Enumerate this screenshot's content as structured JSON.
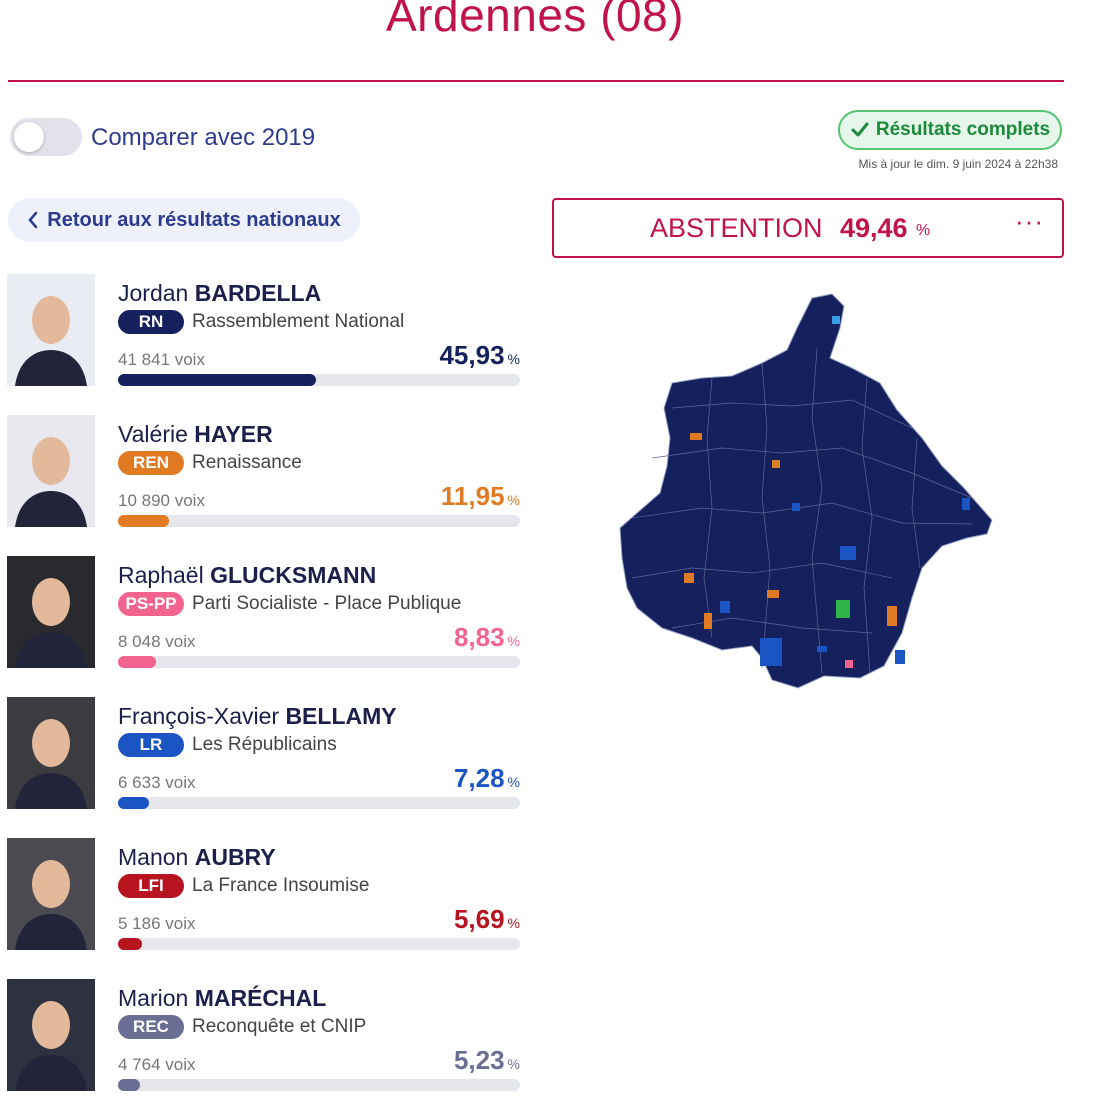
{
  "header": {
    "title": "Ardennes (08)"
  },
  "compare": {
    "label": "Comparer avec 2019"
  },
  "status": {
    "badge": "Résultats complets",
    "updated": "Mis à jour le dim. 9 juin 2024 à 22h38"
  },
  "nav": {
    "back_label": "Retour aux résultats nationaux"
  },
  "abstention": {
    "label": "ABSTENTION",
    "value": "49,46",
    "unit": "%"
  },
  "candidates": [
    {
      "first": "Jordan",
      "last": "BARDELLA",
      "party_code": "RN",
      "party_name": "Rassemblement National",
      "votes": "41 841 voix",
      "pct": "45,93",
      "unit": "%",
      "share": 45.93,
      "color": "#15215c",
      "photo_bg": "#e9edf3"
    },
    {
      "first": "Valérie",
      "last": "HAYER",
      "party_code": "REN",
      "party_name": "Renaissance",
      "votes": "10 890 voix",
      "pct": "11,95",
      "unit": "%",
      "share": 11.95,
      "color": "#e07b24",
      "photo_bg": "#e8e8ee"
    },
    {
      "first": "Raphaël",
      "last": "GLUCKSMANN",
      "party_code": "PS-PP",
      "party_name": "Parti Socialiste - Place Publique",
      "votes": "8 048 voix",
      "pct": "8,83",
      "unit": "%",
      "share": 8.83,
      "color": "#f2648f",
      "photo_bg": "#2a2a2e"
    },
    {
      "first": "François-Xavier",
      "last": "BELLAMY",
      "party_code": "LR",
      "party_name": "Les Républicains",
      "votes": "6 633 voix",
      "pct": "7,28",
      "unit": "%",
      "share": 7.28,
      "color": "#1b55c3",
      "photo_bg": "#3b3b40"
    },
    {
      "first": "Manon",
      "last": "AUBRY",
      "party_code": "LFI",
      "party_name": "La France Insoumise",
      "votes": "5 186 voix",
      "pct": "5,69",
      "unit": "%",
      "share": 5.69,
      "color": "#b7141f",
      "photo_bg": "#4a4a50"
    },
    {
      "first": "Marion",
      "last": "MARÉCHAL",
      "party_code": "REC",
      "party_name": "Reconquête et CNIP",
      "votes": "4 764 voix",
      "pct": "5,23",
      "unit": "%",
      "share": 5.23,
      "color": "#6b6e94",
      "photo_bg": "#2d3140"
    }
  ],
  "colors": {
    "accent": "#c0134a",
    "map_fill": "#15215c",
    "map_border": "#9aa3c8"
  },
  "icons": {
    "check": "check-icon",
    "chevron": "chevron-left-icon",
    "more": "more-icon"
  }
}
